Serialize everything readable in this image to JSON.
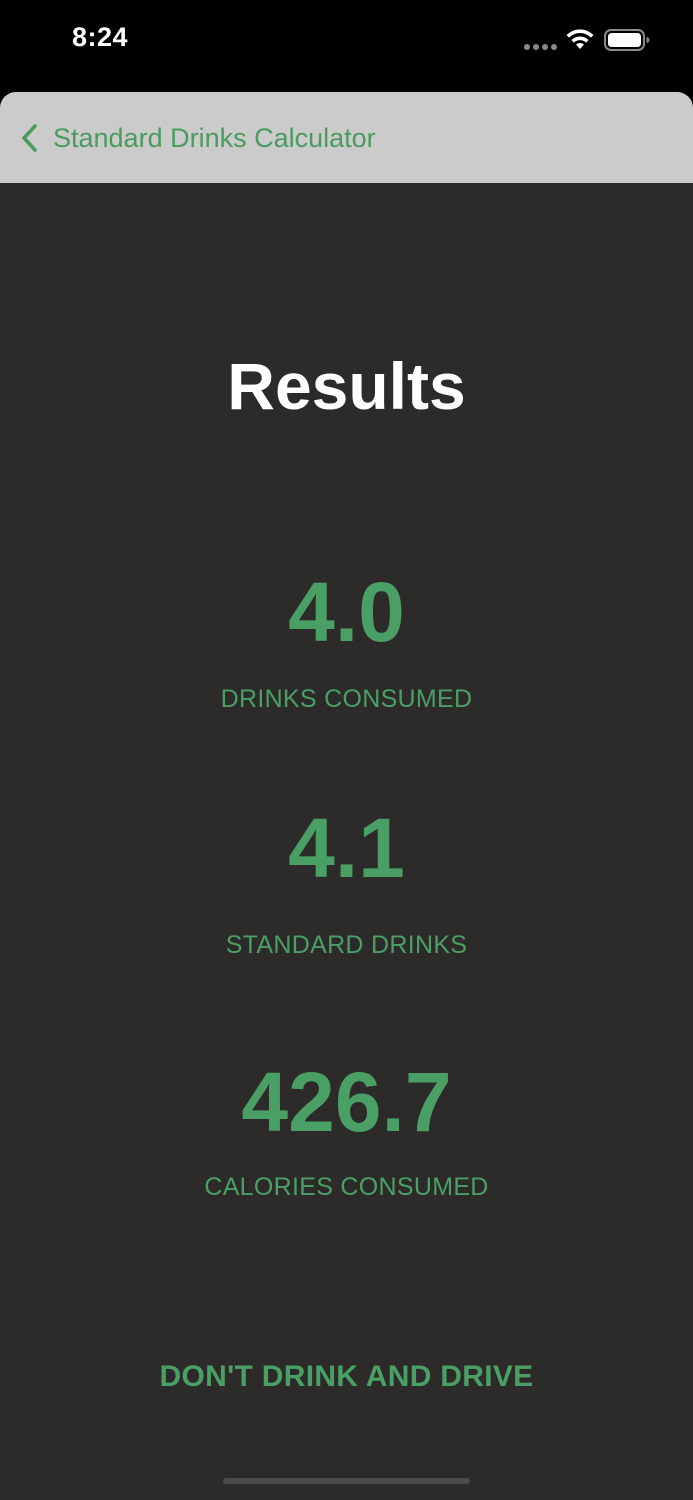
{
  "status_bar": {
    "time": "8:24"
  },
  "nav": {
    "back_label": "Standard Drinks Calculator",
    "back_icon": "chevron-left-icon"
  },
  "page": {
    "title": "Results"
  },
  "results": [
    {
      "value": "4.0",
      "label": "DRINKS CONSUMED"
    },
    {
      "value": "4.1",
      "label": "STANDARD DRINKS"
    },
    {
      "value": "426.7",
      "label": "CALORIES CONSUMED"
    }
  ],
  "warning": "DON'T DRINK AND DRIVE",
  "colors": {
    "accent": "#4aa064",
    "background": "#2d2a2a",
    "nav_background": "#cbcbcb",
    "status_bar": "#000000"
  }
}
